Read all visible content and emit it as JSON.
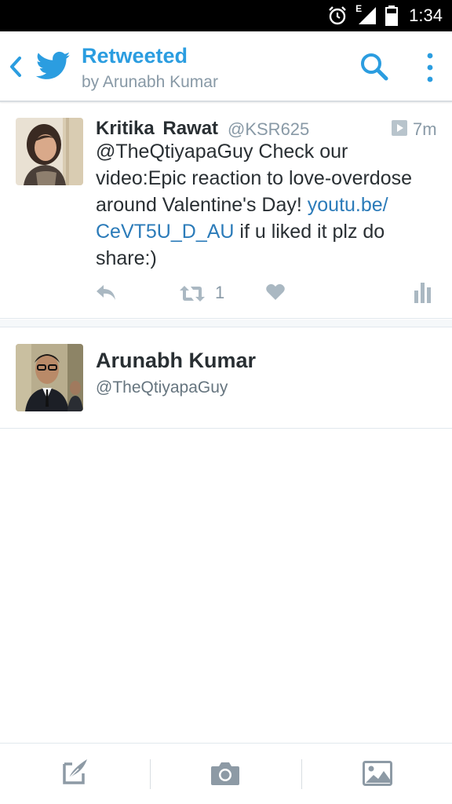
{
  "status_bar": {
    "time": "1:34",
    "network_type": "E",
    "icons": [
      "alarm-icon",
      "signal-icon",
      "battery-icon"
    ]
  },
  "app_bar": {
    "title": "Retweeted",
    "subtitle": "by Arunabh Kumar",
    "icons": [
      "back-icon",
      "twitter-bird-icon",
      "search-icon",
      "more-icon"
    ]
  },
  "tweet": {
    "name": "Kritika  Rawat",
    "handle": "@KSR625",
    "time": "7m",
    "text_before_link": "@TheQtiyapaGuy  Check our video:Epic reaction to love-overdose around Valentine's Day! ",
    "link": "youtu.be/ CeVT5U_D_AU",
    "text_after_link": " if u liked it plz do share:)",
    "retweet_count": "1",
    "action_icons": [
      "reply-icon",
      "retweet-icon",
      "like-icon",
      "analytics-icon"
    ]
  },
  "retweeters": [
    {
      "name": "Arunabh Kumar",
      "handle": "@TheQtiyapaGuy"
    }
  ],
  "bottom_bar": {
    "icons": [
      "compose-icon",
      "camera-icon",
      "gallery-icon"
    ]
  },
  "colors": {
    "accent": "#2b9de0",
    "link": "#2b7bb9",
    "muted": "#8899a6",
    "text": "#292f33"
  }
}
